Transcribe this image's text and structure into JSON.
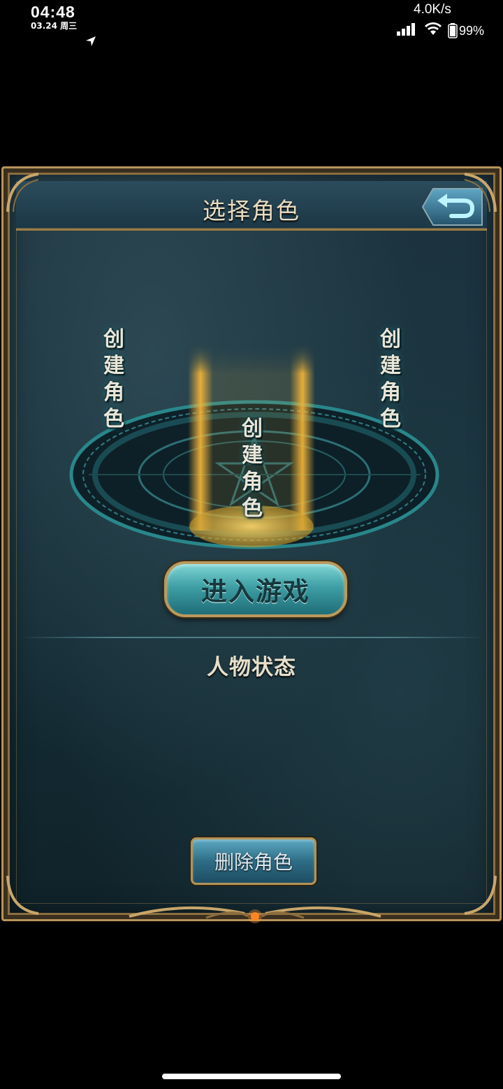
{
  "status_bar": {
    "time": "04:48",
    "date": "03.24 周三",
    "network_speed": "4.0K/s",
    "battery": "99%"
  },
  "game": {
    "title": "选择角色",
    "slots": [
      {
        "label": "创建角色"
      },
      {
        "label": "创建角色"
      },
      {
        "label": "创建角色"
      }
    ],
    "enter_button": "进入游戏",
    "status_heading": "人物状态",
    "delete_button": "删除角色"
  },
  "colors": {
    "frame_gold": "#b8935a",
    "panel_teal": "#17303a",
    "enter_button_teal": "#3e9fa4",
    "pillar_gold": "#f0b43a"
  }
}
